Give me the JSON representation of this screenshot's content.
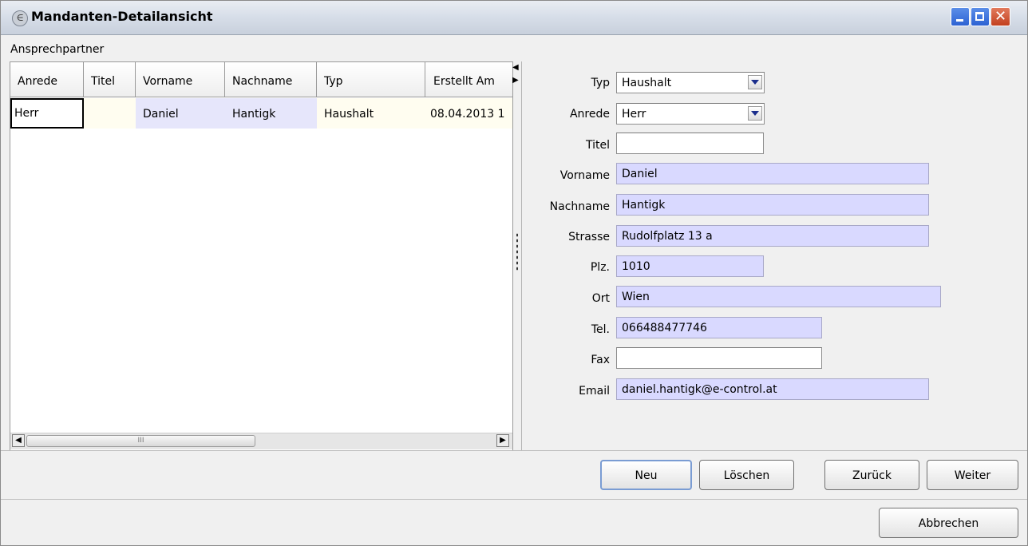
{
  "window": {
    "title": "Mandanten-Detailansicht",
    "app_icon_glyph": "∈",
    "minimize_icon": "minimize-icon",
    "maximize_icon": "maximize-icon",
    "close_glyph": "✕"
  },
  "section": {
    "label": "Ansprechpartner"
  },
  "grid": {
    "columns": [
      "Anrede",
      "Titel",
      "Vorname",
      "Nachname",
      "Typ",
      "Erstellt Am"
    ],
    "rows": [
      [
        "Herr",
        "",
        "Daniel",
        "Hantigk",
        "Haushalt",
        "08.04.2013 1"
      ]
    ],
    "scroll_left_glyph": "◀",
    "scroll_right_glyph": "▶",
    "scroll_thumb_grip": "III",
    "col_nav_left_glyph": "◀",
    "col_nav_right_glyph": "▶"
  },
  "form": {
    "typ": {
      "label": "Typ",
      "value": "Haushalt"
    },
    "anrede": {
      "label": "Anrede",
      "value": "Herr"
    },
    "titel": {
      "label": "Titel",
      "value": ""
    },
    "vorname": {
      "label": "Vorname",
      "value": "Daniel"
    },
    "nachname": {
      "label": "Nachname",
      "value": "Hantigk"
    },
    "strasse": {
      "label": "Strasse",
      "value": "Rudolfplatz 13 a"
    },
    "plz": {
      "label": "Plz.",
      "value": "1010"
    },
    "ort": {
      "label": "Ort",
      "value": "Wien"
    },
    "tel": {
      "label": "Tel.",
      "value": "066488477746"
    },
    "fax": {
      "label": "Fax",
      "value": ""
    },
    "email": {
      "label": "Email",
      "value": "daniel.hantigk@e-control.at"
    }
  },
  "actions": {
    "neu": "Neu",
    "loeschen": "Löschen",
    "zurueck": "Zurück",
    "weiter": "Weiter",
    "abbrechen": "Abbrechen"
  },
  "colors": {
    "lavender_field": "#d9d9ff",
    "title_bar_blue": "#2d62d3",
    "close_red": "#c2401f"
  }
}
